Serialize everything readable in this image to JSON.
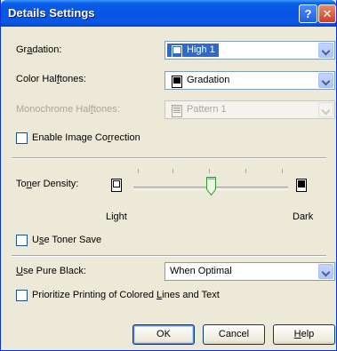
{
  "window": {
    "title": "Details Settings"
  },
  "titlebar": {
    "help_glyph": "?",
    "close_glyph": "✕"
  },
  "gradation": {
    "label_pre": "Gr",
    "label_ul": "a",
    "label_post": "dation:",
    "value": "High 1"
  },
  "color_halftones": {
    "label_pre": "Color Hal",
    "label_ul": "f",
    "label_post": "tones:",
    "value": "Gradation"
  },
  "mono_halftones": {
    "label_pre": "Monochrome Hal",
    "label_ul": "f",
    "label_post": "tones:",
    "value": "Pattern 1"
  },
  "image_correction": {
    "label_pre": "Enable Image Co",
    "label_ul": "r",
    "label_post": "rection",
    "checked": false
  },
  "toner_density": {
    "label_pre": "To",
    "label_ul": "n",
    "label_post": "er Density:",
    "min_label": "Light",
    "max_label": "Dark",
    "level_fraction": 0.5
  },
  "toner_save": {
    "label_pre": "U",
    "label_ul": "s",
    "label_post": "e Toner Save",
    "checked": false
  },
  "pure_black": {
    "label_pre": "",
    "label_ul": "U",
    "label_post": "se Pure Black:",
    "value": "When Optimal"
  },
  "prioritize_lines": {
    "label_pre": "Prioritize Printing of Colored ",
    "label_ul": "L",
    "label_post": "ines and Text",
    "checked": false
  },
  "buttons": {
    "ok": "OK",
    "cancel": "Cancel",
    "help_pre": "",
    "help_ul": "H",
    "help_post": "elp"
  },
  "colors": {
    "titlebar": "#0a5fe8",
    "dialog_bg": "#ece9d8",
    "selection": "#316ac5",
    "disabled_text": "#a7a69a"
  },
  "icons": [
    "help-button-icon",
    "close-button-icon",
    "page-dark-icon",
    "page-light-icon",
    "pattern-icon",
    "dropdown-arrow-icon",
    "slider-thumb-icon"
  ]
}
